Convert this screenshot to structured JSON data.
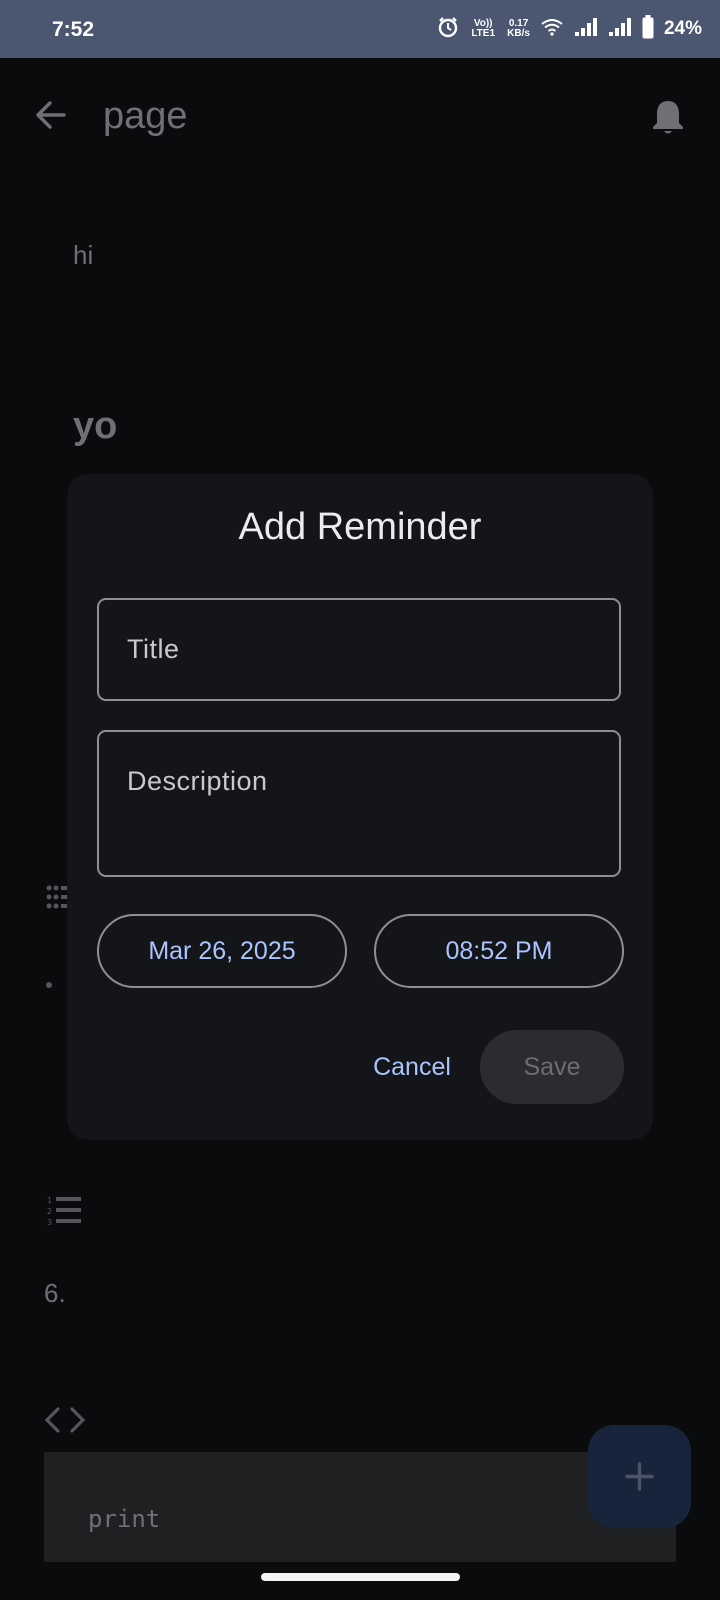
{
  "status_bar": {
    "time": "7:52",
    "network_label": "Vo)) LTE1",
    "speed_value": "0.17",
    "speed_unit": "KB/s",
    "battery_percent": "24%"
  },
  "app_bar": {
    "title": "page",
    "back_icon": "arrow-back-icon",
    "bell_icon": "bell-icon"
  },
  "note": {
    "line1": "hi",
    "heading": "yo",
    "numbered_item": "6.",
    "code": "print"
  },
  "dialog": {
    "title": "Add Reminder",
    "title_placeholder": "Title",
    "description_placeholder": "Description",
    "date": "Mar 26, 2025",
    "time": "08:52 PM",
    "cancel_label": "Cancel",
    "save_label": "Save"
  },
  "colors": {
    "accent": "#a9c4ff",
    "background": "#0a0b0d",
    "dialog": "#141519",
    "status_bar": "#4b5670"
  }
}
